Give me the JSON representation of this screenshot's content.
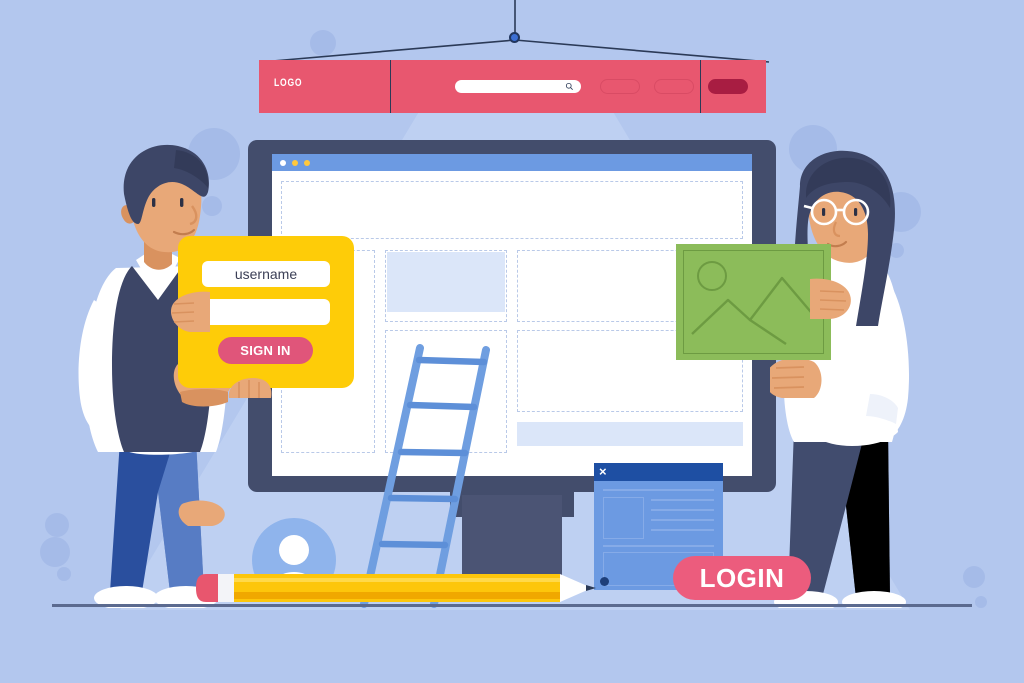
{
  "scene": {
    "title": "Login page concept flat illustration",
    "background_color": "#b3c7ee",
    "ground_color": "#5b6a8f"
  },
  "navbar": {
    "background_color": "#e8576f",
    "logo_text": "LOGO",
    "search": {
      "placeholder": "",
      "value": "",
      "icon": "search-icon"
    },
    "pills": [
      {
        "name": "nav-pill-one",
        "style": "outline",
        "label": ""
      },
      {
        "name": "nav-pill-two",
        "style": "outline",
        "label": ""
      },
      {
        "name": "nav-pill-cta",
        "style": "filled",
        "label": "",
        "color": "#a81d42"
      }
    ],
    "hanger": {
      "pin_color": "#3c6fd4",
      "wire_color": "#2b3a57"
    }
  },
  "monitor": {
    "frame_color": "#434d6c",
    "browser_bar_color": "#6c9ae2",
    "traffic_lights": [
      "#ffffff",
      "#ffc83d",
      "#ffc83d"
    ],
    "wireframe": {
      "hero_block": "dashed-placeholder",
      "filled_blocks": 2,
      "fill_color": "#dbe6f9",
      "dash_color": "#b9c9e8"
    }
  },
  "login_card": {
    "background_color": "#fecc08",
    "username_field": {
      "value": "username",
      "placeholder": "username"
    },
    "password_field": {
      "value": "",
      "placeholder": ""
    },
    "submit_label": "SIGN IN",
    "submit_color": "#e0557a"
  },
  "login_pill": {
    "label": "LOGIN",
    "color": "#ec5c7d"
  },
  "dialog": {
    "title_bar_color": "#1e4fa3",
    "body_color": "#6c9ae2",
    "close_icon": "close-icon",
    "close_glyph": "×"
  },
  "image_card": {
    "color": "#8cbc5a",
    "icon": "image-placeholder-icon"
  },
  "props": {
    "ladder": {
      "name": "ladder",
      "color": "#6f9ee0",
      "rungs": 6
    },
    "pencil": {
      "name": "pencil",
      "body_color": "#fdc60b",
      "eraser_color": "#e8566e"
    },
    "avatar": {
      "name": "user-avatar-icon",
      "circle_color": "#8fb4ec",
      "glyph_color": "#ffffff"
    }
  },
  "people": [
    {
      "name": "person-left",
      "role": "man-holding-login-form",
      "hair": "#3d4667",
      "shirt": "#ffffff",
      "vest": "#3d4667",
      "pants": "#2a4f9e",
      "skin": "#e8a878"
    },
    {
      "name": "person-right",
      "role": "woman-holding-image-card",
      "hair": "#3d4667",
      "shirt": "#ffffff",
      "pants": "#414c6e",
      "skin": "#e8a878",
      "accessory": "glasses"
    }
  ]
}
